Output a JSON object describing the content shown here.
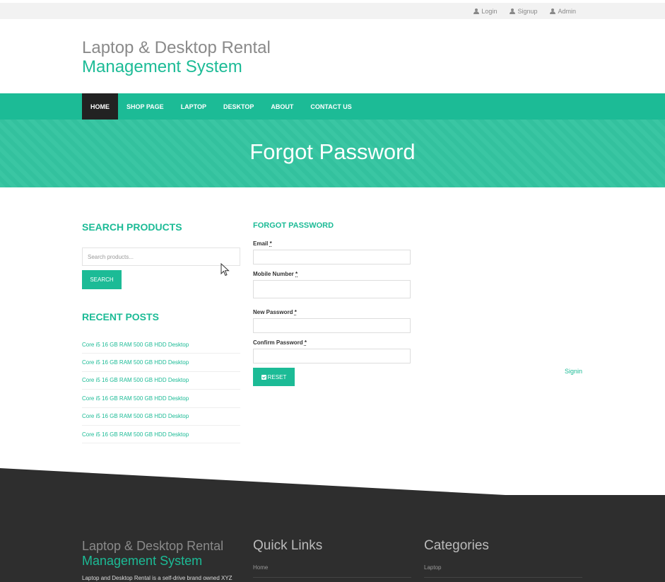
{
  "topbar": {
    "links": [
      {
        "label": "Login",
        "icon": "user-icon"
      },
      {
        "label": "Signup",
        "icon": "user-icon"
      },
      {
        "label": "Admin",
        "icon": "user-icon"
      }
    ]
  },
  "logo": {
    "line1": "Laptop & Desktop Rental",
    "line2": "Management System"
  },
  "nav": {
    "items": [
      "HOME",
      "SHOP PAGE",
      "LAPTOP",
      "DESKTOP",
      "ABOUT",
      "CONTACT US"
    ],
    "active": "HOME"
  },
  "hero": {
    "title": "Forgot Password"
  },
  "sidebar": {
    "search_heading": "SEARCH PRODUCTS",
    "search_placeholder": "Search products...",
    "search_button": "SEARCH",
    "recent_heading": "RECENT POSTS",
    "posts": [
      "Core i5 16 GB RAM 500 GB HDD Desktop",
      "Core i5 16 GB RAM 500 GB HDD Desktop",
      "Core i5 16 GB RAM 500 GB HDD Desktop",
      "Core i5 16 GB RAM 500 GB HDD Desktop",
      "Core i5 16 GB RAM 500 GB HDD Desktop",
      "Core i5 16 GB RAM 500 GB HDD Desktop"
    ]
  },
  "form": {
    "heading": "FORGOT PASSWORD",
    "email_label": "Email",
    "mobile_label": "Mobile Number",
    "new_password_label": "New Password",
    "confirm_password_label": "Confirm Password",
    "required_marker": "*",
    "reset_button": "RESET",
    "signin_link": "Signin"
  },
  "footer": {
    "logo_line1": "Laptop & Desktop Rental",
    "logo_line2": "Management System",
    "description": "Laptop and Desktop Rental is a self-drive brand owned XYZ",
    "quick_links_title": "Quick Links",
    "quick_links": [
      "Home"
    ],
    "categories_title": "Categories",
    "categories": [
      "Laptop"
    ]
  },
  "colors": {
    "accent": "#1cbb96",
    "hero": "#34c4a0",
    "footer": "#2e2e2e",
    "nav_active": "#222222",
    "topbar": "#f2f2f2"
  }
}
